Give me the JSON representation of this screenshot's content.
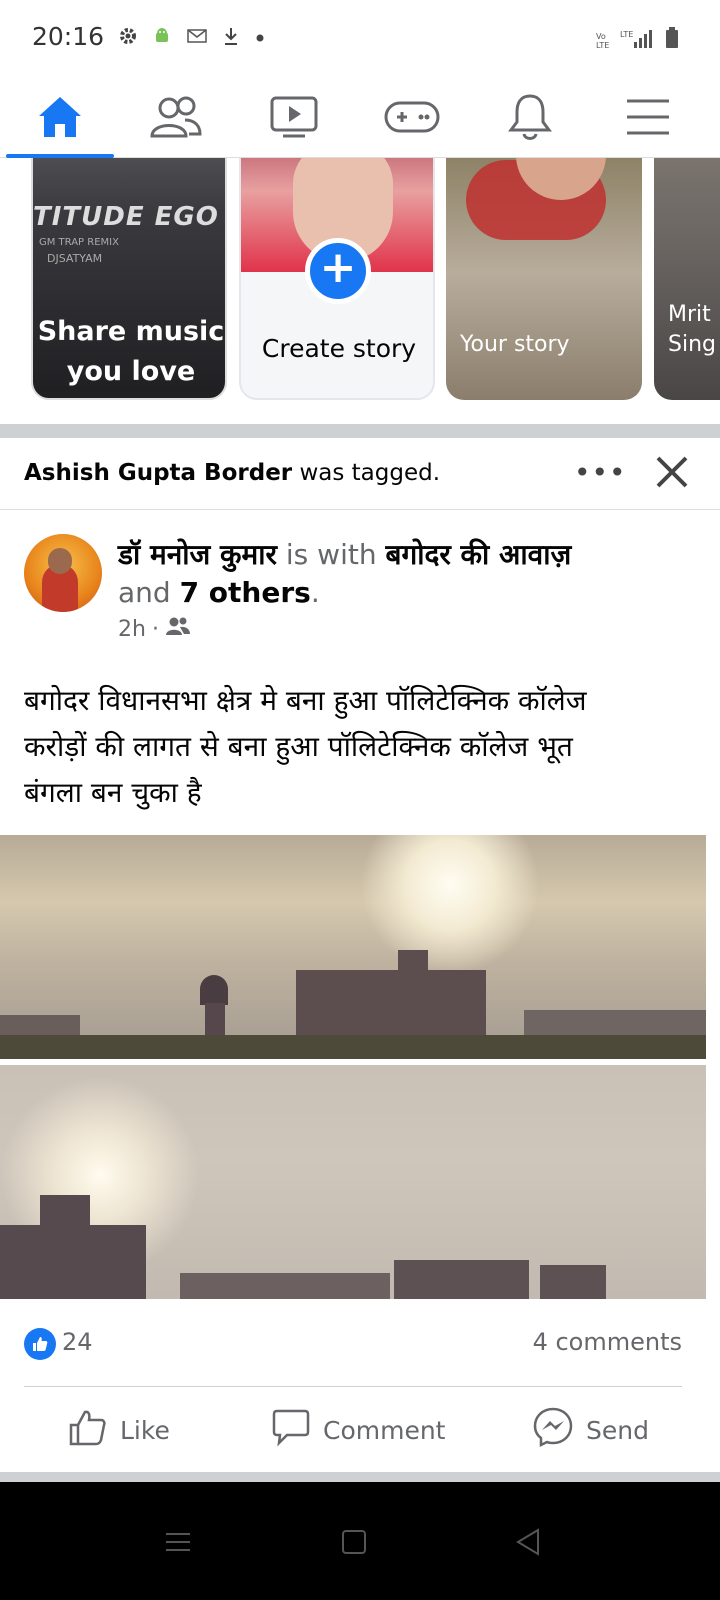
{
  "status_bar": {
    "time": "20:16",
    "icons": [
      "gear-icon",
      "android-icon",
      "mail-icon",
      "download-icon",
      "dot-icon"
    ],
    "network": "LTE",
    "volte": "Vo LTE"
  },
  "top_nav": {
    "items": [
      "home-icon",
      "friends-icon",
      "watch-icon",
      "gaming-icon",
      "notifications-icon",
      "menu-icon"
    ],
    "active": "home",
    "accent_color": "#1877f2"
  },
  "stories": {
    "share_music": {
      "brand": "TITUDE EGO",
      "sub1": "GM TRAP REMIX",
      "sub2": "DJSATYAM",
      "title_line1": "Share music",
      "title_line2": "you love"
    },
    "create_story": {
      "label": "Create story",
      "plus": "+"
    },
    "your_story": {
      "label": "Your story"
    },
    "friend_story": {
      "label_line1": "Mrit",
      "label_line2": "Sing"
    }
  },
  "tagged_header": {
    "name": "Ashish Gupta Border",
    "suffix": " was tagged.",
    "more": "•••"
  },
  "post": {
    "author": "डॉ मनोज कुमार",
    "with_text": " is with ",
    "tagged_page": "बगोदर की आवाज़",
    "and_text": "and ",
    "others": "7 others",
    "period": ".",
    "time": "2h",
    "separator": "·",
    "audience_icon": "friends-audience-icon",
    "body_line1": "बगोदर विधानसभा क्षेत्र मे बना हुआ पॉलिटेक्निक कॉलेज",
    "body_line2": "करोड़ों की लागत से बना हुआ पॉलिटेक्निक कॉलेज भूत",
    "body_line3": "बंगला बन चुका है"
  },
  "reactions": {
    "likes": "24",
    "comments": "4 comments"
  },
  "actions": {
    "like": "Like",
    "comment": "Comment",
    "send": "Send"
  }
}
